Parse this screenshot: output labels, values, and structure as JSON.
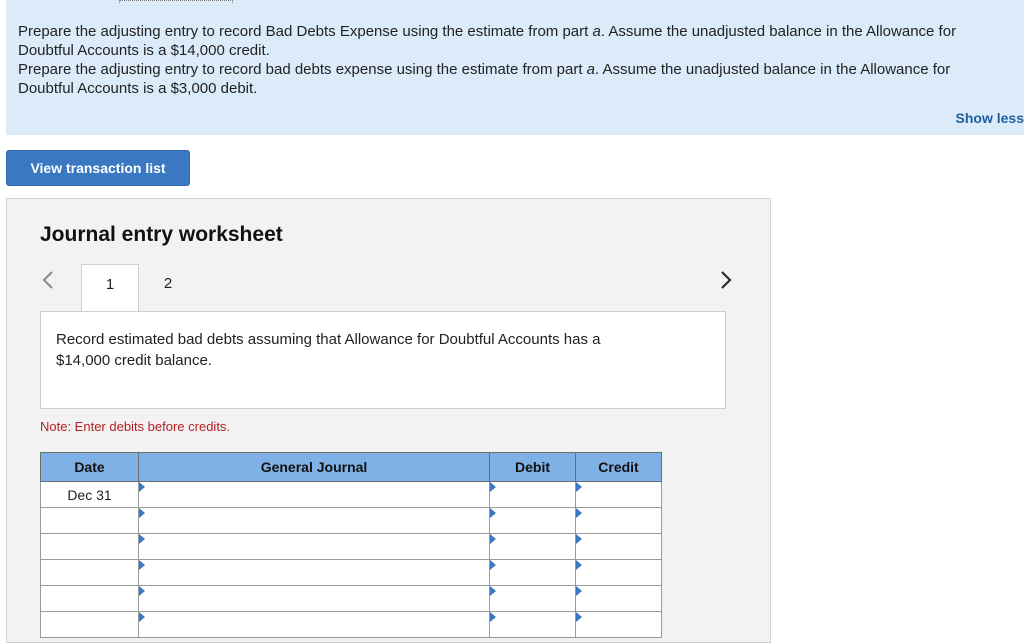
{
  "instructions": {
    "line1_a": "Prepare the adjusting entry to record Bad Debts Expense using the estimate from part ",
    "line1_part": "a",
    "line1_b": ". Assume the unadjusted balance in the Allowance for Doubtful Accounts is a $14,000 credit.",
    "line2_a": "Prepare the adjusting entry to record bad debts expense using the estimate from part ",
    "line2_part": "a",
    "line2_b": ". Assume the unadjusted balance in the Allowance for Doubtful Accounts is a $3,000 debit.",
    "show_less": "Show less"
  },
  "buttons": {
    "view_transaction_list": "View transaction list"
  },
  "worksheet": {
    "title": "Journal entry worksheet",
    "tabs": [
      "1",
      "2"
    ],
    "active_tab": "1",
    "description": "Record estimated bad debts assuming that Allowance for Doubtful Accounts has a $14,000 credit balance.",
    "note": "Note: Enter debits before credits."
  },
  "journal": {
    "headers": [
      "Date",
      "General Journal",
      "Debit",
      "Credit"
    ],
    "rows": [
      {
        "date": "Dec 31",
        "account": "",
        "debit": "",
        "credit": ""
      },
      {
        "date": "",
        "account": "",
        "debit": "",
        "credit": ""
      },
      {
        "date": "",
        "account": "",
        "debit": "",
        "credit": ""
      },
      {
        "date": "",
        "account": "",
        "debit": "",
        "credit": ""
      },
      {
        "date": "",
        "account": "",
        "debit": "",
        "credit": ""
      },
      {
        "date": "",
        "account": "",
        "debit": "",
        "credit": ""
      }
    ]
  },
  "colors": {
    "instruction_bg": "#dcebf9",
    "button_blue": "#3a78c2",
    "header_blue": "#7fb0e6",
    "note_red": "#b51f24"
  }
}
